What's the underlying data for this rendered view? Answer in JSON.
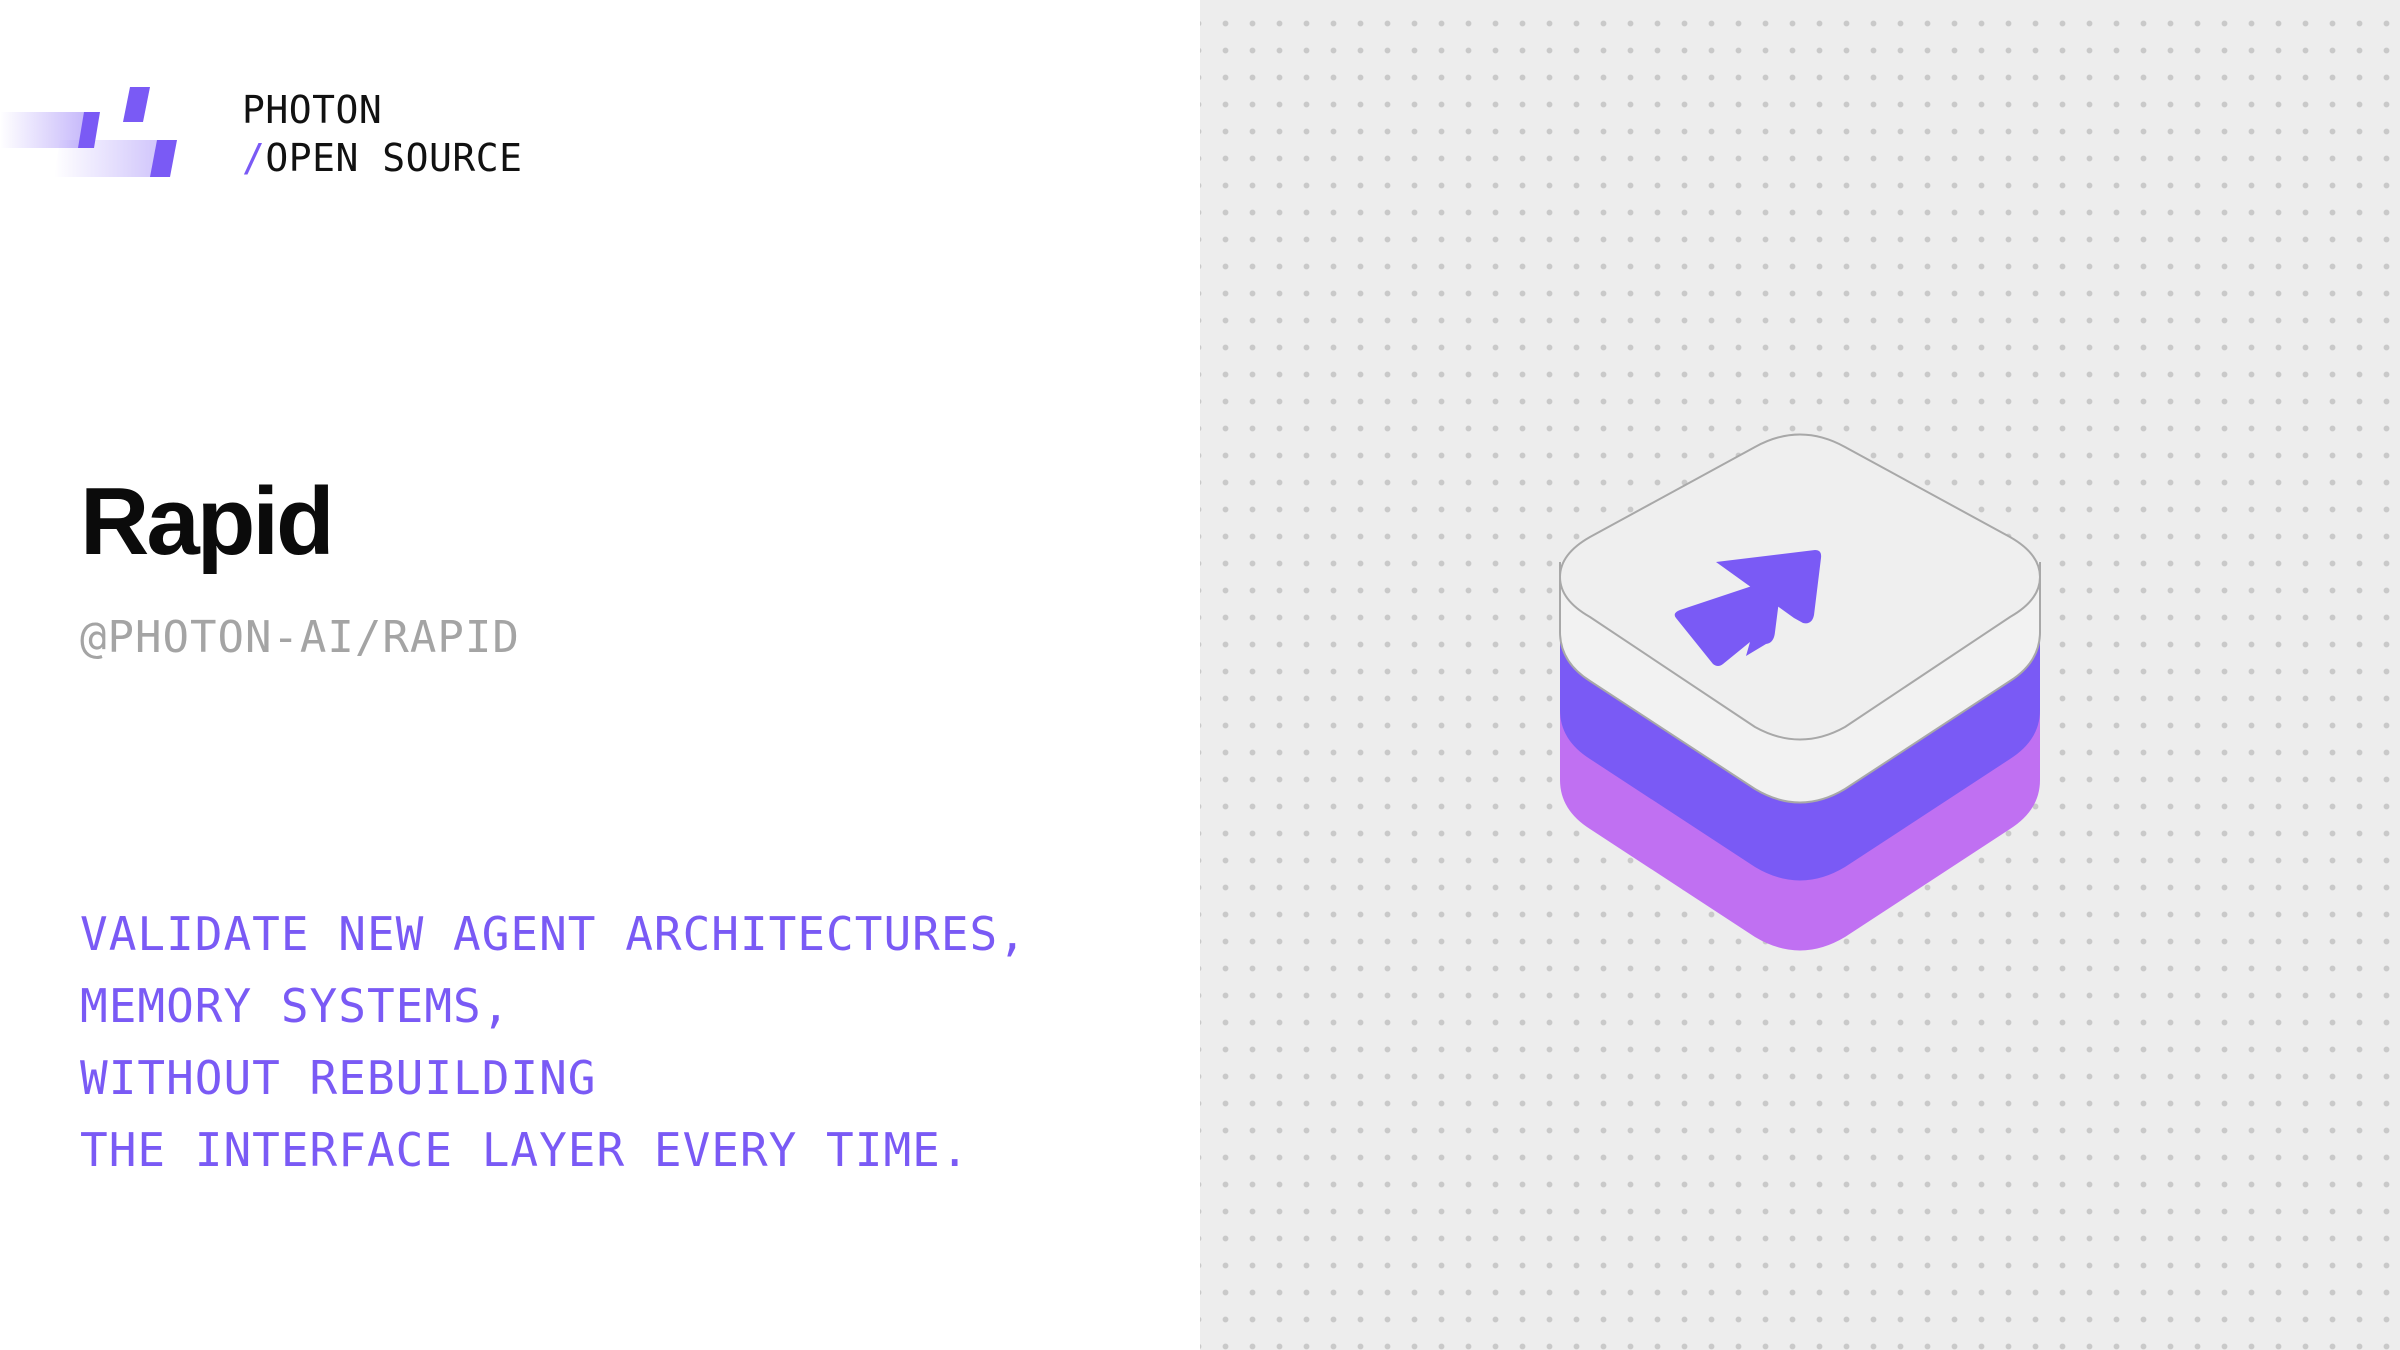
{
  "brand": {
    "name": "PHOTON",
    "slash": "/",
    "subtitle": "OPEN SOURCE"
  },
  "project": {
    "title": "Rapid",
    "package": "@PHOTON-AI/RAPID"
  },
  "tagline": [
    "VALIDATE NEW AGENT ARCHITECTURES,",
    "MEMORY SYSTEMS,",
    "WITHOUT REBUILDING",
    "THE INTERFACE LAYER EVERY TIME."
  ],
  "colors": {
    "accent": "#7a5af5",
    "accent_light": "#c070f2",
    "panel_background": "#ededed",
    "package_text": "#a4a4a4"
  },
  "icons": {
    "brand_logo": "photon-logo-icon",
    "illustration": "rapid-stack-icon",
    "arrow": "fast-forward-arrow-icon"
  }
}
